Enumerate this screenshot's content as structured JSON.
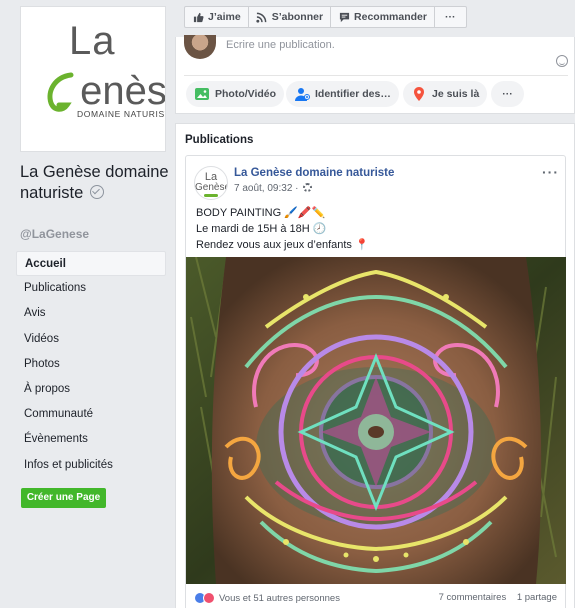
{
  "page": {
    "logo": {
      "line1": "La",
      "line2": "Genèse",
      "line3": "DOMAINE NATURISTE"
    },
    "name": "La Genèse domaine naturiste",
    "handle": "@LaGenese"
  },
  "nav": {
    "items": [
      {
        "label": "Accueil",
        "active": true
      },
      {
        "label": "Publications"
      },
      {
        "label": "Avis"
      },
      {
        "label": "Vidéos"
      },
      {
        "label": "Photos"
      },
      {
        "label": "À propos"
      },
      {
        "label": "Communauté"
      },
      {
        "label": "Évènements"
      },
      {
        "label": "Infos et publicités"
      }
    ],
    "create_page": "Créer une Page"
  },
  "actions": {
    "like": "J’aime",
    "subscribe": "S’abonner",
    "recommend": "Recommander",
    "more": "···"
  },
  "composer": {
    "placeholder": "Ecrire une publication.",
    "photo_video": "Photo/Vidéo",
    "tag": "Identifier des…",
    "checkin": "Je suis là",
    "more": "···"
  },
  "feed": {
    "title": "Publications",
    "post": {
      "avatar_line1": "La",
      "avatar_line2": "Genèse",
      "author": "La Genèse domaine naturiste",
      "time": "7 août, 09:32 ·",
      "more": "···",
      "lines": [
        "BODY PAINTING 🖌️🖍️✏️",
        "Le mardi de 15H à 18H 🕗",
        "Rendez vous aux jeux d’enfants 📍"
      ],
      "reactions_text": "Vous et 51 autres personnes",
      "comments": "7 commentaires",
      "shares": "1 partage"
    }
  },
  "colors": {
    "link": "#365899",
    "create_button": "#42b72a",
    "background": "#e9ebee"
  }
}
